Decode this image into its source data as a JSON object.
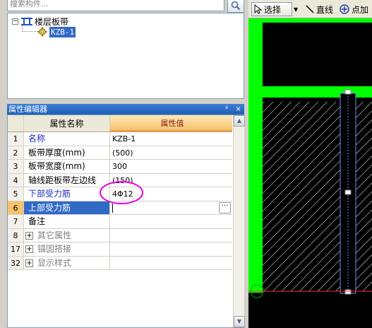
{
  "search": {
    "placeholder": "搜索构件..."
  },
  "tree": {
    "root_label": "楼层板带",
    "root_expander": "−",
    "child_label": "KZB-1"
  },
  "property_panel": {
    "title": "属性编辑器",
    "pin_glyph": "ᵖ",
    "close_glyph": "×",
    "header": {
      "name": "属性名称",
      "value": "属性值"
    },
    "rows": [
      {
        "num": "1",
        "name": "名称",
        "value": "KZB-1"
      },
      {
        "num": "2",
        "name": "板带厚度(mm)",
        "value": "(500)"
      },
      {
        "num": "3",
        "name": "板带宽度(mm)",
        "value": "300"
      },
      {
        "num": "4",
        "name": "轴线距板带左边线",
        "value": "(150)"
      },
      {
        "num": "5",
        "name": "下部受力筋",
        "value": "4Φ12"
      },
      {
        "num": "6",
        "name": "上部受力筋",
        "value": ""
      },
      {
        "num": "7",
        "name": "备注",
        "value": ""
      },
      {
        "num": "8",
        "name": "其它属性",
        "value": ""
      },
      {
        "num": "17",
        "name": "锚固搭接",
        "value": ""
      },
      {
        "num": "32",
        "name": "显示样式",
        "value": ""
      }
    ],
    "ellipsis": "···",
    "group_toggle": "+"
  },
  "toolbar": {
    "select_label": "选择",
    "line_label": "直线",
    "point_label": "点加"
  },
  "colors": {
    "canvas_bg": "#000000",
    "slab_green": "#00ff00",
    "annotation": "#e400e4",
    "selection": "#316ac5",
    "header_value_bg": "#f6c26d"
  }
}
